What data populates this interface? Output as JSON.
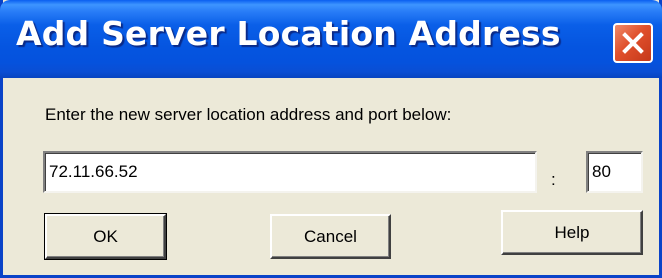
{
  "dialog": {
    "title": "Add Server Location Address",
    "prompt": "Enter the new server location address and port below:",
    "address_value": "72.11.66.52",
    "separator": ":",
    "port_value": "80",
    "ok_label": "OK",
    "cancel_label": "Cancel",
    "help_label": "Help",
    "close_icon": "close-icon"
  },
  "colors": {
    "titlebar": "#0555e0",
    "window_background": "#ece9d8",
    "close_button": "#e0502c"
  }
}
